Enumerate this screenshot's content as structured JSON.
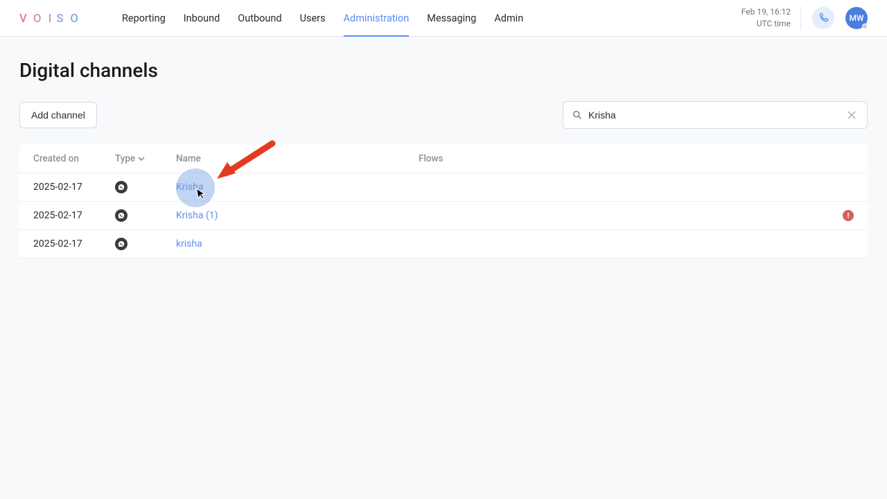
{
  "header": {
    "logo_text": "VOISO",
    "nav": [
      {
        "label": "Reporting",
        "active": false
      },
      {
        "label": "Inbound",
        "active": false
      },
      {
        "label": "Outbound",
        "active": false
      },
      {
        "label": "Users",
        "active": false
      },
      {
        "label": "Administration",
        "active": true
      },
      {
        "label": "Messaging",
        "active": false
      },
      {
        "label": "Admin",
        "active": false
      }
    ],
    "time_line1": "Feb 19, 16:12",
    "time_line2": "UTC time",
    "avatar_initials": "MW"
  },
  "page": {
    "title": "Digital channels",
    "add_button": "Add channel",
    "search_value": "Krisha"
  },
  "table": {
    "headers": {
      "created": "Created on",
      "type": "Type",
      "name": "Name",
      "flows": "Flows"
    },
    "rows": [
      {
        "created": "2025-02-17",
        "type": "whatsapp",
        "name": "Krisha",
        "flows": "",
        "alert": false
      },
      {
        "created": "2025-02-17",
        "type": "whatsapp",
        "name": "Krisha (1)",
        "flows": "",
        "alert": true
      },
      {
        "created": "2025-02-17",
        "type": "whatsapp",
        "name": "krisha",
        "flows": "",
        "alert": false
      }
    ]
  }
}
